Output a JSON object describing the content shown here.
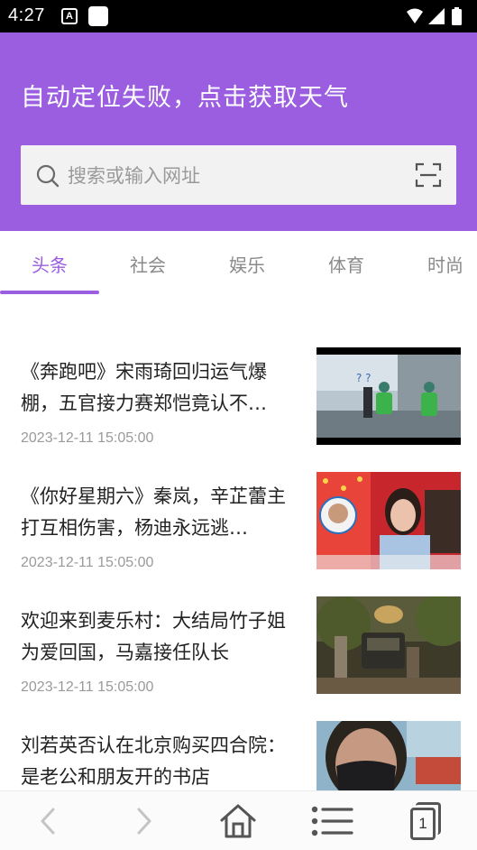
{
  "status_bar": {
    "time": "4:27",
    "notif_letter": "A"
  },
  "header": {
    "weather_text": "自动定位失败，点击获取天气",
    "search_placeholder": "搜索或输入网址"
  },
  "tabs": [
    {
      "label": "头条",
      "active": true
    },
    {
      "label": "社会",
      "active": false
    },
    {
      "label": "娱乐",
      "active": false
    },
    {
      "label": "体育",
      "active": false
    },
    {
      "label": "时尚",
      "active": false
    }
  ],
  "news": [
    {
      "title": "《奔跑吧》宋雨琦回归运气爆棚，五官接力赛郑恺竟认不…",
      "time": "2023-12-11 15:05:00",
      "thumb": "variety-show-outdoor-image"
    },
    {
      "title": "《你好星期六》秦岚，辛芷蕾主打互相伤害，杨迪永远逃…",
      "time": "2023-12-11 15:05:00",
      "thumb": "variety-show-stage-image"
    },
    {
      "title": "欢迎来到麦乐村：大结局竹子姐为爱回国，马嘉接任队长",
      "time": "2023-12-11 15:05:00",
      "thumb": "village-night-scene-image"
    },
    {
      "title": "刘若英否认在北京购买四合院：是老公和朋友开的书店",
      "time": "",
      "thumb": "masked-person-selfie-image"
    }
  ],
  "bottom_nav": {
    "tab_count": "1"
  },
  "colors": {
    "accent": "#9b5ee0",
    "status_bar": "#000000"
  }
}
